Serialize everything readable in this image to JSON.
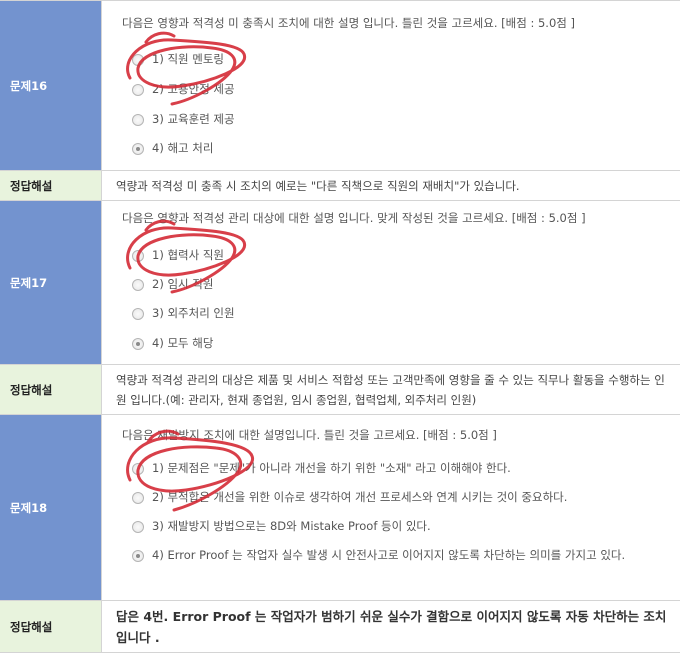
{
  "questions": [
    {
      "label": "문제16",
      "text": "다음은 영향과 적격성 미 충족시 조치에 대한 설명 입니다. 틀린 것을 고르세요. [배점 : 5.0점 ]",
      "options": [
        "1) 직원 멘토링",
        "2) 고용안정 제공",
        "3) 교육훈련 제공",
        "4) 해고 처리"
      ],
      "selected": 3,
      "answer_label": "정답해설",
      "answer": "역량과 적격성 미 충족 시 조치의 예로는 \"다른 직책으로 직원의 재배치\"가 있습니다."
    },
    {
      "label": "문제17",
      "text": "다음은 영향과 적격성 관리 대상에 대한 설명 입니다. 맞게 작성된 것을 고르세요. [배점 : 5.0점 ]",
      "options": [
        "1) 협력사 직원",
        "2) 임시 직원",
        "3) 외주처리 인원",
        "4) 모두 해당"
      ],
      "selected": 3,
      "answer_label": "정답해설",
      "answer": "역량과 적격성 관리의 대상은 제품 및 서비스 적합성 또는 고객만족에 영향을 줄 수 있는 직무나 활동을 수행하는 인원 입니다.(예: 관리자, 현재 종업원, 임시 종업원, 협력업체, 외주처리 인원)"
    },
    {
      "label": "문제18",
      "text": "다음은 재발방지 조치에 대한 설명입니다. 틀린 것을 고르세요. [배점 : 5.0점 ]",
      "options": [
        "1) 문제점은 \"문제\"가 아니라 개선을 하기 위한 \"소재\" 라고 이해해야 한다.",
        "2) 부적합은 개선을 위한 이슈로 생각하여 개선 프로세스와 연계 시키는 것이 중요하다.",
        "3) 재발방지 방법으로는 8D와 Mistake Proof 등이 있다.",
        "4) Error Proof 는 작업자 실수 발생 시 안전사고로 이어지지 않도록 차단하는 의미를 가지고 있다."
      ],
      "selected": 3,
      "answer_label": "정답해설",
      "answer": "답은 4번. Error Proof 는 작업자가 범하기 쉬운 실수가 결함으로 이어지지 않도록 자동 차단하는 조치입니다 ."
    }
  ],
  "colors": {
    "question_label_bg": "#7393cf",
    "answer_label_bg": "#e8f3dd",
    "scribble": "#d42a35"
  },
  "icons": [
    "radio-button-icon",
    "scribble-mark"
  ]
}
